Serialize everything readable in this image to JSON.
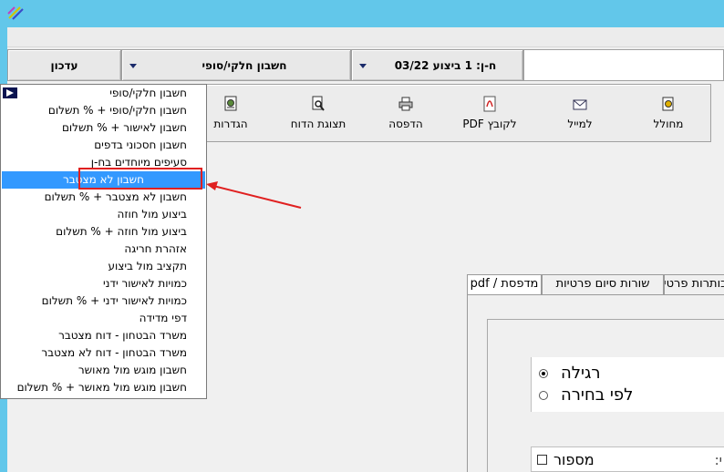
{
  "header": {
    "update_button": "עדכון",
    "report_type_combo": "חשבון חלקי/סופי",
    "period_combo": "ח-ן: 1 ביצוע 03/22"
  },
  "toolbar": {
    "wizard": "מחולל",
    "to_mail": "למייל",
    "to_pdf": "לקובץ PDF",
    "print": "הדפסה",
    "preview": "תצוגת הדוח",
    "settings": "הגדרות"
  },
  "dropdown": {
    "items": [
      "חשבון חלקי/סופי",
      "חשבון חלקי/סופי + % תשלום",
      "חשבון לאישור + % תשלום",
      "חשבון חסכוני בדפים",
      "סעיפים מיוחדים בח-ן",
      "חשבון לא מצטבר",
      "חשבון לא מצטבר + % תשלום",
      "ביצוע מול חוזה",
      "ביצוע מול חוזה + % תשלום",
      "אזהרת חריגה",
      "תקציב מול ביצוע",
      "כמויות לאישור ידני",
      "כמויות לאישור ידני + % תשלום",
      "דפי מדידה",
      "משרד הבטחון - דוח מצטבר",
      "משרד הבטחון - דוח לא מצטבר",
      "חשבון מוגש מול מאושר",
      "חשבון מוגש מול מאושר + % תשלום"
    ],
    "selected_index": 5
  },
  "tabs": [
    "מדפסת / pdf",
    "שורות סיום פרטיות",
    "כותרות פרטיות"
  ],
  "radio_options": [
    "רגילה",
    "לפי בחירה"
  ],
  "number_label": "מספור",
  "truncated_label": ":י",
  "colors": {
    "titlebar": "#62c7ea",
    "selection": "#3399ff",
    "annotation": "#e02020"
  }
}
